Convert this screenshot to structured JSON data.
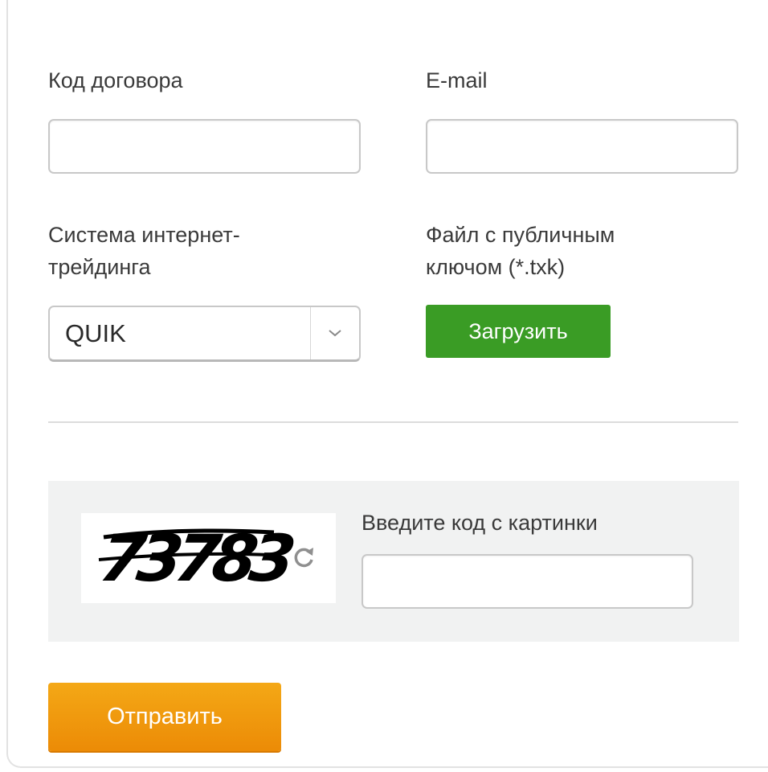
{
  "form": {
    "contract_code": {
      "label": "Код договора",
      "value": ""
    },
    "email": {
      "label": "E-mail",
      "value": ""
    },
    "trading_system": {
      "label_line1": "Система интернет-",
      "label_line2": "трейдинга",
      "selected": "QUIK"
    },
    "public_key": {
      "label_line1": "Файл с публичным",
      "label_line2": "ключом (*.txk)",
      "upload_label": "Загрузить"
    },
    "captcha": {
      "image_text": "73783",
      "label": "Введите код с картинки",
      "value": "",
      "refresh_icon": "refresh-icon"
    },
    "submit_label": "Отправить"
  },
  "colors": {
    "upload_button": "#3a9c25",
    "submit_button": "#f0960d",
    "captcha_background": "#f1f2f2"
  }
}
